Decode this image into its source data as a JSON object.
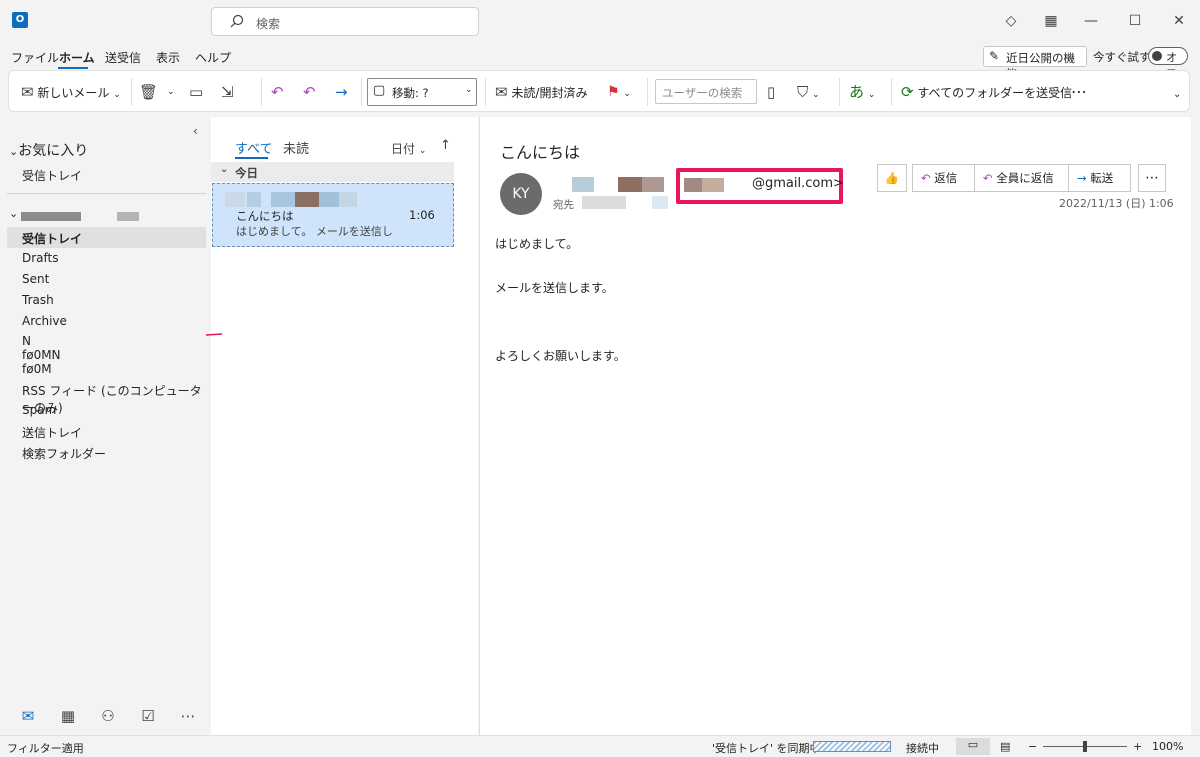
{
  "titlebar": {
    "app_icon": "outlook-icon",
    "search_placeholder": "検索",
    "icons": [
      "diamond-icon",
      "qr-icon",
      "minimize-icon",
      "maximize-icon",
      "close-icon"
    ]
  },
  "menu": {
    "items": [
      "ファイル",
      "ホーム",
      "送受信",
      "表示",
      "ヘルプ"
    ],
    "new_features": "近日公開の機能",
    "try_now": "今すぐ試す",
    "toggle_label": "オフ"
  },
  "ribbon": {
    "new_mail": "新しいメール",
    "move": "移動: ?",
    "read_unread": "未読/開封済み",
    "people_search": "ユーザーの検索",
    "send_receive_all": "すべてのフォルダーを送受信"
  },
  "folders": {
    "favorites_header": "お気に入り",
    "favorites": [
      "受信トレイ"
    ],
    "inbox_selected": "受信トレイ",
    "items": [
      "Drafts",
      "Sent",
      "Trash",
      "Archive",
      "N",
      "fø0MN",
      "fø0M",
      "RSS フィード (このコンピューターのみ)",
      "Spam",
      "送信トレイ",
      "検索フォルダー"
    ]
  },
  "message_list": {
    "tab_all": "すべて",
    "tab_unread": "未読",
    "sort_by": "日付",
    "group_today": "今日",
    "message": {
      "subject": "こんにちは",
      "preview": "はじめまして。 メールを送信し",
      "time": "1:06"
    }
  },
  "reading_pane": {
    "subject": "こんにちは",
    "avatar_initials": "KY",
    "sender_email": "@gmail.com>",
    "to_label": "宛先",
    "reply": "返信",
    "reply_all": "全員に返信",
    "forward": "転送",
    "date": "2022/11/13 (日) 1:06",
    "body": [
      "はじめまして。",
      "メールを送信します。",
      "よろしくお願いします。"
    ]
  },
  "statusbar": {
    "filter": "フィルター適用",
    "sync": "'受信トレイ' を同期中",
    "connection": "接続中",
    "zoom": "100%"
  },
  "colors": {
    "accent": "#0f6cbd",
    "highlight": "#e8175d",
    "selected_message": "#cfe4fa"
  }
}
